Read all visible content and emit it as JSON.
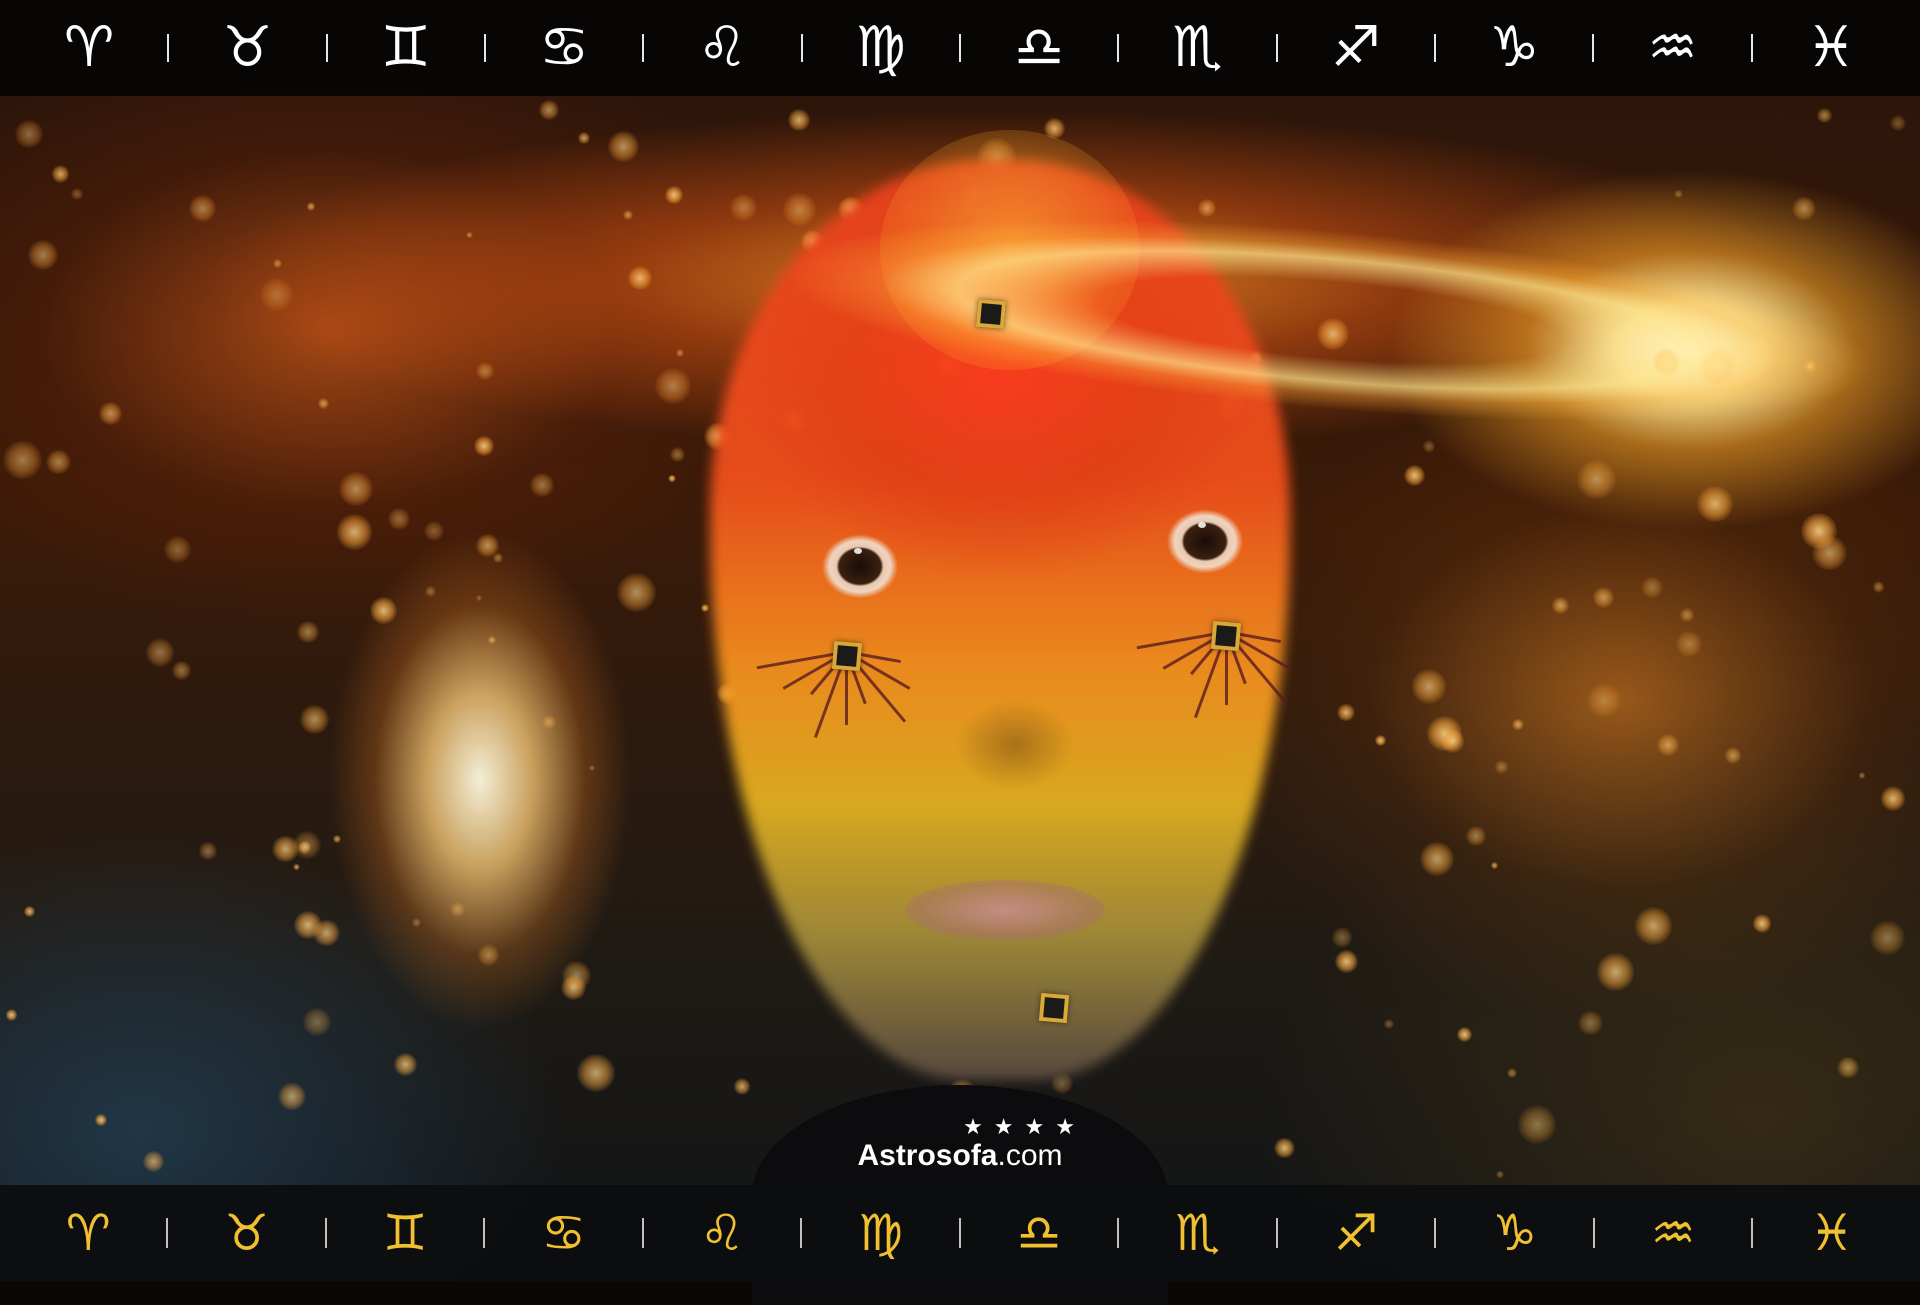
{
  "zodiac_top": {
    "glyphs": [
      "♈",
      "♉",
      "♊",
      "♋",
      "♌",
      "♍",
      "♎",
      "♏",
      "♐",
      "♑",
      "♒",
      "♓"
    ],
    "color": "#ffffff"
  },
  "zodiac_bottom": {
    "icons": [
      "aries-ram-icon",
      "taurus-bull-icon",
      "gemini-twins-icon",
      "cancer-crab-icon",
      "leo-lion-icon",
      "virgo-maiden-icon",
      "libra-scales-icon",
      "scorpio-scorpion-icon",
      "sagittarius-archer-icon",
      "capricorn-goat-icon",
      "aquarius-water-bearer-icon",
      "pisces-fish-icon"
    ],
    "glyphs": [
      "♈",
      "♉",
      "♊",
      "♋",
      "♌",
      "♍",
      "♎",
      "♏",
      "♐",
      "♑",
      "♒",
      "♓"
    ],
    "accent": "#f0c030"
  },
  "logo": {
    "name": "Astrosofa",
    "tld": ".com",
    "stars": "★ ★ ★ ★"
  },
  "palette": {
    "glow_orange": "#ff8a1e",
    "face_red": "#e6401e",
    "bar_black": "#050505"
  }
}
